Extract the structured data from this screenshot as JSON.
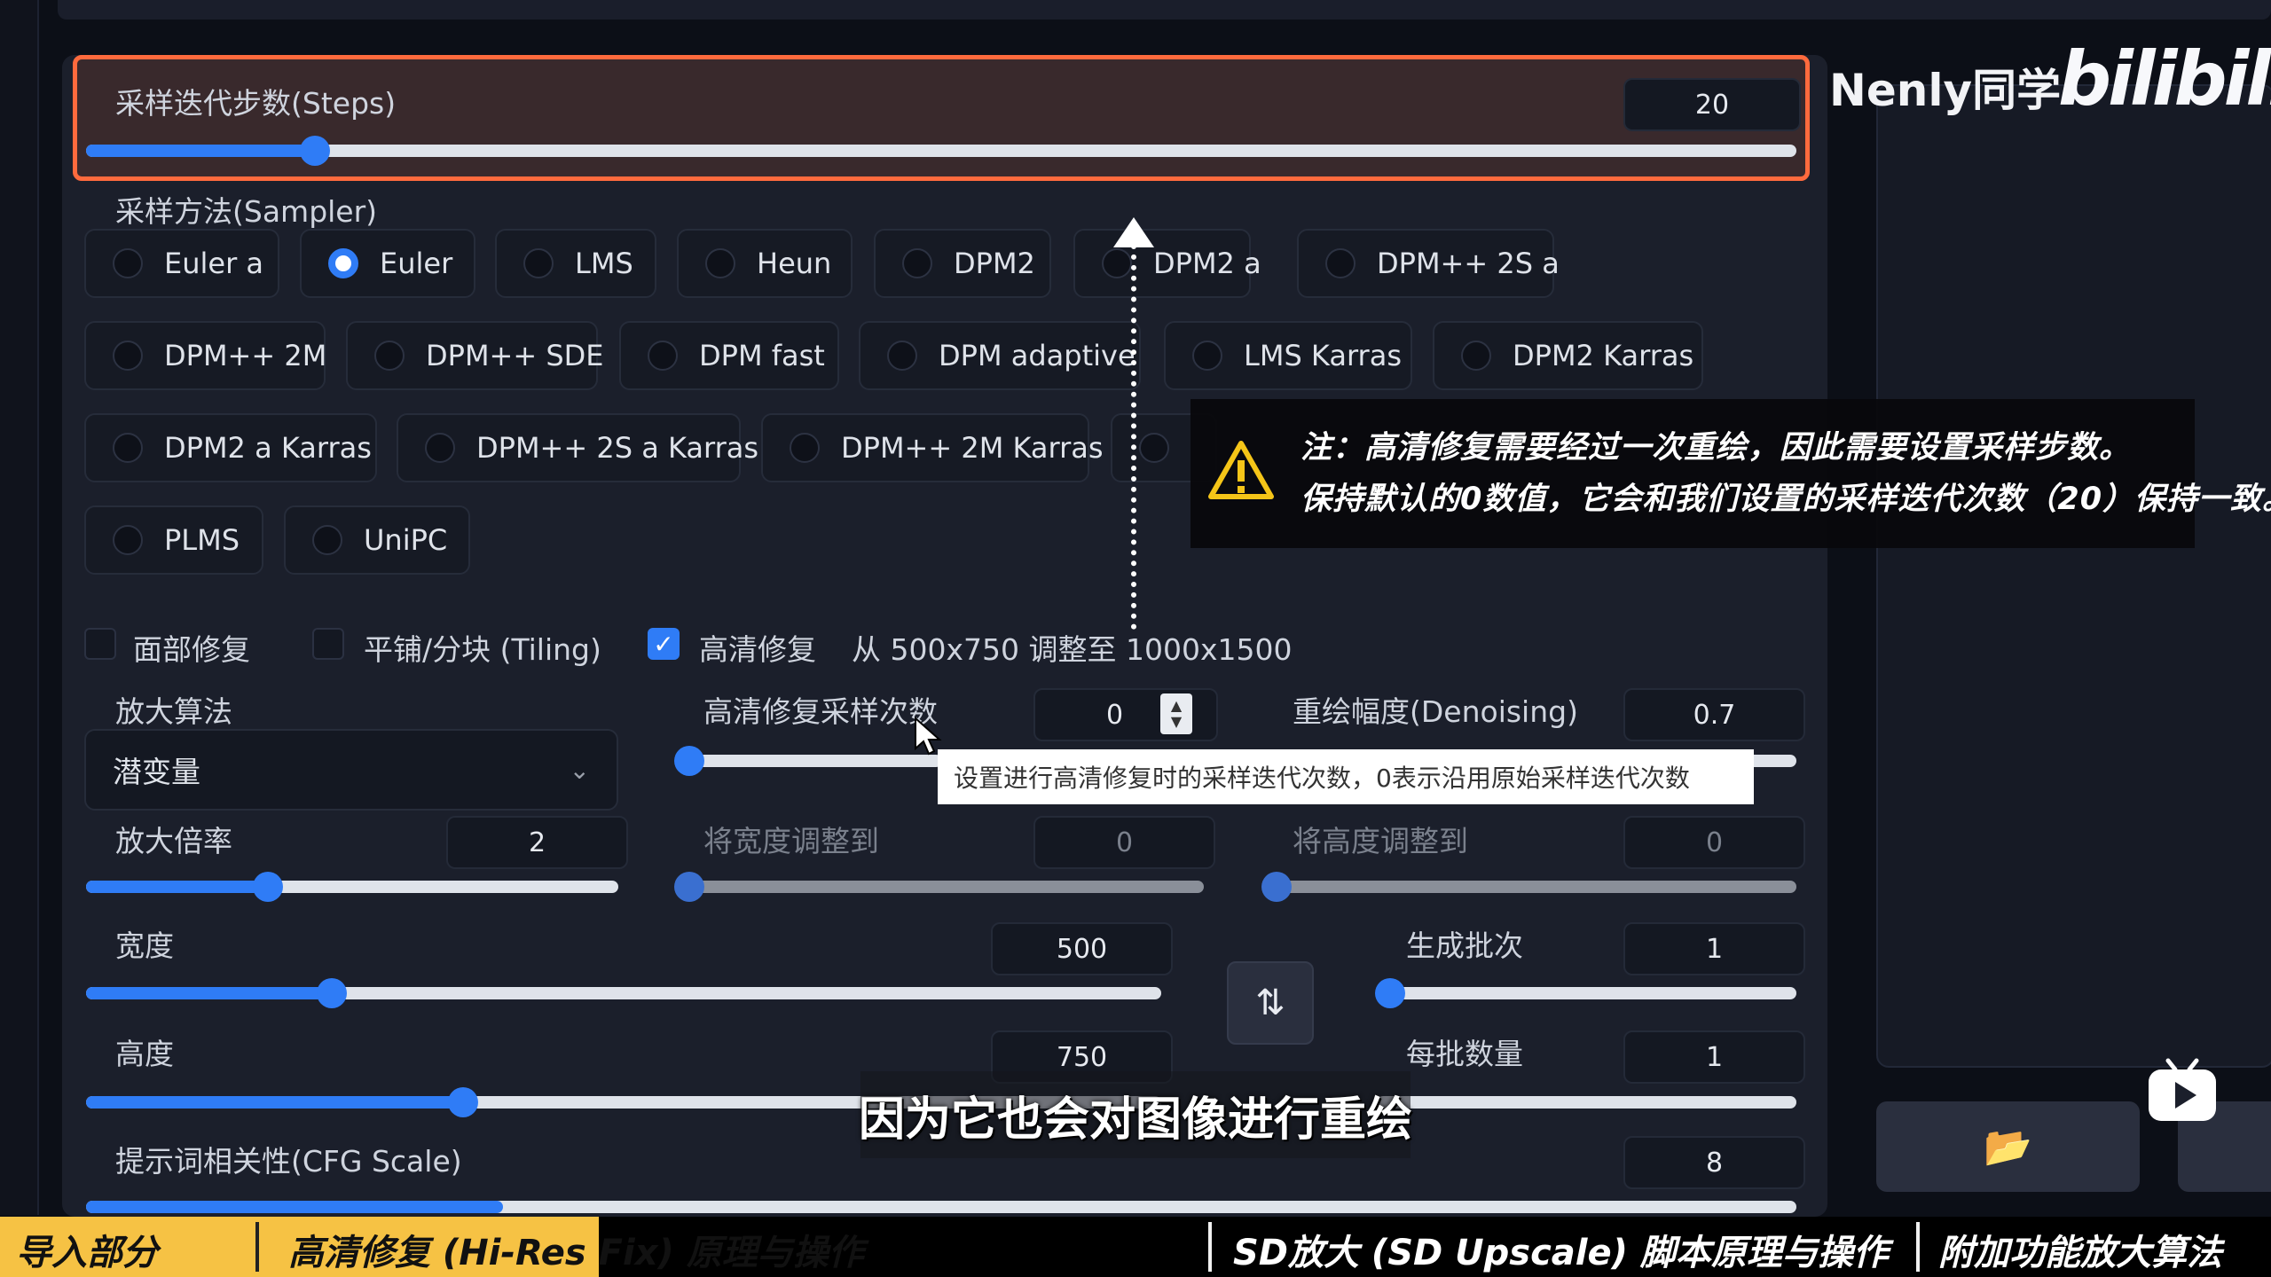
{
  "steps": {
    "label": "采样迭代步数(Steps)",
    "value": "20",
    "fraction": 0.133
  },
  "sampler": {
    "label": "采样方法(Sampler)",
    "options": [
      "Euler a",
      "Euler",
      "LMS",
      "Heun",
      "DPM2",
      "DPM2 a",
      "DPM++ 2S a",
      "DPM++ 2M",
      "DPM++ SDE",
      "DPM fast",
      "DPM adaptive",
      "LMS Karras",
      "DPM2 Karras",
      "DPM2 a Karras",
      "DPM++ 2S a Karras",
      "DPM++ 2M Karras",
      "",
      "PLMS",
      "UniPC"
    ],
    "selected": "Euler"
  },
  "checks": {
    "face_restore": "面部修复",
    "tiling": "平铺/分块 (Tiling)",
    "hires_fix": "高清修复",
    "hires_fix_checked": true,
    "resize_info": "从 500x750 调整至 1000x1500"
  },
  "upscaler": {
    "label": "放大算法",
    "value": "潜变量"
  },
  "hires_steps": {
    "label": "高清修复采样次数",
    "value": "0",
    "tooltip": "设置进行高清修复时的采样迭代次数，0表示沿用原始采样迭代次数"
  },
  "denoising": {
    "label": "重绘幅度(Denoising)",
    "value": "0.7"
  },
  "upscale_by": {
    "label": "放大倍率",
    "value": "2"
  },
  "resize_width": {
    "label": "将宽度调整到",
    "value": "0"
  },
  "resize_height": {
    "label": "将高度调整到",
    "value": "0"
  },
  "width": {
    "label": "宽度",
    "value": "500"
  },
  "height": {
    "label": "高度",
    "value": "750"
  },
  "batch_count": {
    "label": "生成批次",
    "value": "1"
  },
  "batch_size": {
    "label": "每批数量",
    "value": "1"
  },
  "cfg": {
    "label": "提示词相关性(CFG Scale)",
    "value": "8"
  },
  "swap_icon": "swap-arrows-icon",
  "folder_icon": "folder-icon",
  "note": {
    "line1": "注：高清修复需要经过一次重绘，因此需要设置采样步数。",
    "line2": "保持默认的0数值，它会和我们设置的采样迭代次数（20）保持一致。"
  },
  "subtitle": "因为它也会对图像进行重绘",
  "watermark": {
    "author": "Nenly同学",
    "site": "bilibili"
  },
  "chapters": [
    "导入部分",
    "高清修复 (Hi-Res Fix) 原理与操作",
    "SD放大 (SD Upscale) 脚本原理与操作",
    "附加功能放大算法"
  ],
  "colors": {
    "accent": "#2f7cf6",
    "highlight": "#ff6a3d",
    "chapter_active": "#f6c244"
  }
}
